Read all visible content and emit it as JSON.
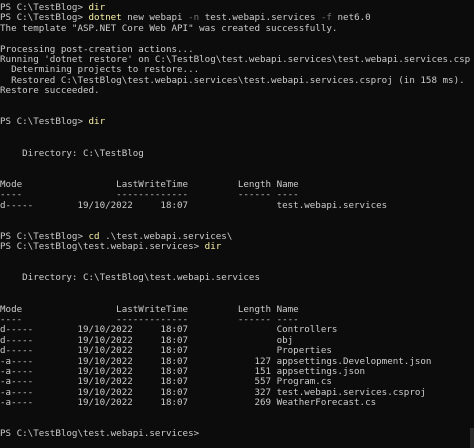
{
  "colors": {
    "background": "#0c0c0c",
    "text": "#cccccc",
    "command": "#f9f1a5",
    "flag": "#767676"
  },
  "lines": [
    [
      {
        "t": "PS C:\\TestBlog> "
      },
      {
        "t": "dir",
        "k": "cmd"
      }
    ],
    [
      {
        "t": "PS C:\\TestBlog> "
      },
      {
        "t": "dotnet",
        "k": "cmd"
      },
      {
        "t": " new webapi "
      },
      {
        "t": "-n",
        "k": "flag"
      },
      {
        "t": " test.webapi.services "
      },
      {
        "t": "-f",
        "k": "flag"
      },
      {
        "t": " net6.0"
      }
    ],
    [
      {
        "t": "The template \"ASP.NET Core Web API\" was created successfully."
      }
    ],
    [
      {
        "t": ""
      }
    ],
    [
      {
        "t": "Processing post-creation actions..."
      }
    ],
    [
      {
        "t": "Running 'dotnet restore' on C:\\TestBlog\\test.webapi.services\\test.webapi.services.csproj..."
      }
    ],
    [
      {
        "t": "  Determining projects to restore..."
      }
    ],
    [
      {
        "t": "  Restored C:\\TestBlog\\test.webapi.services\\test.webapi.services.csproj (in 158 ms)."
      }
    ],
    [
      {
        "t": "Restore succeeded."
      }
    ],
    [
      {
        "t": ""
      }
    ],
    [
      {
        "t": ""
      }
    ],
    [
      {
        "t": "PS C:\\TestBlog> "
      },
      {
        "t": "dir",
        "k": "cmd"
      }
    ],
    [
      {
        "t": ""
      }
    ],
    [
      {
        "t": ""
      }
    ],
    [
      {
        "t": "    Directory: C:\\TestBlog"
      }
    ],
    [
      {
        "t": ""
      }
    ],
    [
      {
        "t": ""
      }
    ],
    [
      {
        "t": "Mode                 LastWriteTime         Length Name"
      }
    ],
    [
      {
        "t": "----                 -------------         ------ ----"
      }
    ],
    [
      {
        "t": "d-----        19/10/2022     18:07                test.webapi.services"
      }
    ],
    [
      {
        "t": ""
      }
    ],
    [
      {
        "t": ""
      }
    ],
    [
      {
        "t": "PS C:\\TestBlog> "
      },
      {
        "t": "cd",
        "k": "cmd"
      },
      {
        "t": " .\\test.webapi.services\\"
      }
    ],
    [
      {
        "t": "PS C:\\TestBlog\\test.webapi.services> "
      },
      {
        "t": "dir",
        "k": "cmd"
      }
    ],
    [
      {
        "t": ""
      }
    ],
    [
      {
        "t": ""
      }
    ],
    [
      {
        "t": "    Directory: C:\\TestBlog\\test.webapi.services"
      }
    ],
    [
      {
        "t": ""
      }
    ],
    [
      {
        "t": ""
      }
    ],
    [
      {
        "t": "Mode                 LastWriteTime         Length Name"
      }
    ],
    [
      {
        "t": "----                 -------------         ------ ----"
      }
    ],
    [
      {
        "t": "d-----        19/10/2022     18:07                Controllers"
      }
    ],
    [
      {
        "t": "d-----        19/10/2022     18:07                obj"
      }
    ],
    [
      {
        "t": "d-----        19/10/2022     18:07                Properties"
      }
    ],
    [
      {
        "t": "-a----        19/10/2022     18:07            127 appsettings.Development.json"
      }
    ],
    [
      {
        "t": "-a----        19/10/2022     18:07            151 appsettings.json"
      }
    ],
    [
      {
        "t": "-a----        19/10/2022     18:07            557 Program.cs"
      }
    ],
    [
      {
        "t": "-a----        19/10/2022     18:07            327 test.webapi.services.csproj"
      }
    ],
    [
      {
        "t": "-a----        19/10/2022     18:07            269 WeatherForecast.cs"
      }
    ],
    [
      {
        "t": ""
      }
    ],
    [
      {
        "t": ""
      }
    ],
    [
      {
        "t": "PS C:\\TestBlog\\test.webapi.services> "
      }
    ]
  ]
}
